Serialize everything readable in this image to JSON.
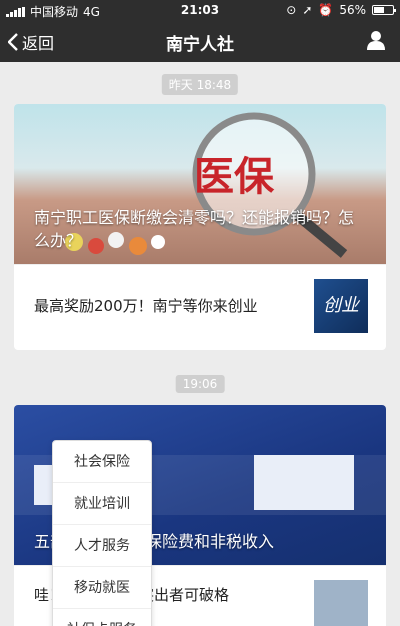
{
  "status": {
    "carrier": "中国移动",
    "network": "4G",
    "time": "21:03",
    "battery": "56%",
    "battery_level": 0.56
  },
  "nav": {
    "back_label": "返回",
    "title": "南宁人社"
  },
  "feed": {
    "time1": "昨天 18:48",
    "article1": {
      "hero_title": "南宁职工医保断缴会清零吗？还能报销吗？怎么办？",
      "sub_title": "最高奖励200万！南宁等你来创业",
      "thumb_text": "创业"
    },
    "time2": "19:06",
    "article2": {
      "hero_title": "五部门部署社会保险费和非税收入",
      "sub_title": "哇！能大赛表现突出者可破格"
    }
  },
  "menu": {
    "items": [
      "社会保险",
      "就业培训",
      "人才服务",
      "移动就医",
      "社保卡服务"
    ]
  },
  "colors": {
    "bar": "#2e2e2e",
    "background": "#ececec"
  }
}
